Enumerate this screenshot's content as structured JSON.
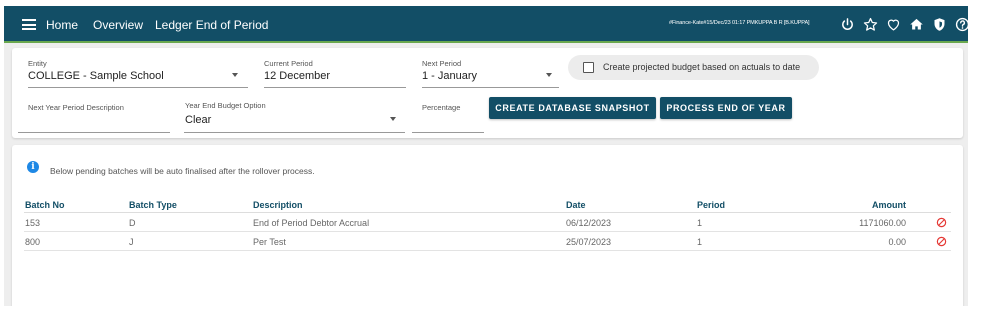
{
  "topbar": {
    "nav": [
      "Home",
      "Overview",
      "Ledger End of Period"
    ],
    "user_info": "#Finance-Kate#15/Dec/23 01:17 PMKUPPA B R [B.KUPPA]",
    "icons": [
      "power-icon",
      "star-icon",
      "heart-icon",
      "home-icon",
      "shield-icon",
      "help-icon"
    ]
  },
  "form": {
    "entity": {
      "label": "Entity",
      "value": "COLLEGE - Sample School"
    },
    "current_period": {
      "label": "Current Period",
      "value": "12 December"
    },
    "next_period": {
      "label": "Next Period",
      "value": "1 - January"
    },
    "projected_checkbox": {
      "label": "Create projected budget based on actuals to date",
      "checked": false
    },
    "next_year_desc": {
      "label": "Next Year Period Description",
      "value": ""
    },
    "year_end_budget": {
      "label": "Year End Budget Option",
      "value": "Clear"
    },
    "percentage": {
      "label": "Percentage",
      "value": ""
    },
    "snapshot_button": "CREATE DATABASE SNAPSHOT",
    "process_button": "PROCESS END OF YEAR"
  },
  "notice": "Below pending batches will be auto finalised after the rollover process.",
  "table": {
    "columns": [
      "Batch No",
      "Batch Type",
      "Description",
      "Date",
      "Period",
      "Amount"
    ],
    "rows": [
      {
        "batch_no": "153",
        "batch_type": "D",
        "description": "End of Period Debtor Accrual",
        "date": "06/12/2023",
        "period": "1",
        "amount": "1171060.00"
      },
      {
        "batch_no": "800",
        "batch_type": "J",
        "description": "Per Test",
        "date": "25/07/2023",
        "period": "1",
        "amount": "0.00"
      }
    ]
  },
  "colors": {
    "primary": "#124e66",
    "accent_line": "#6aa84f",
    "danger": "#e53935",
    "info": "#1e88e5"
  }
}
